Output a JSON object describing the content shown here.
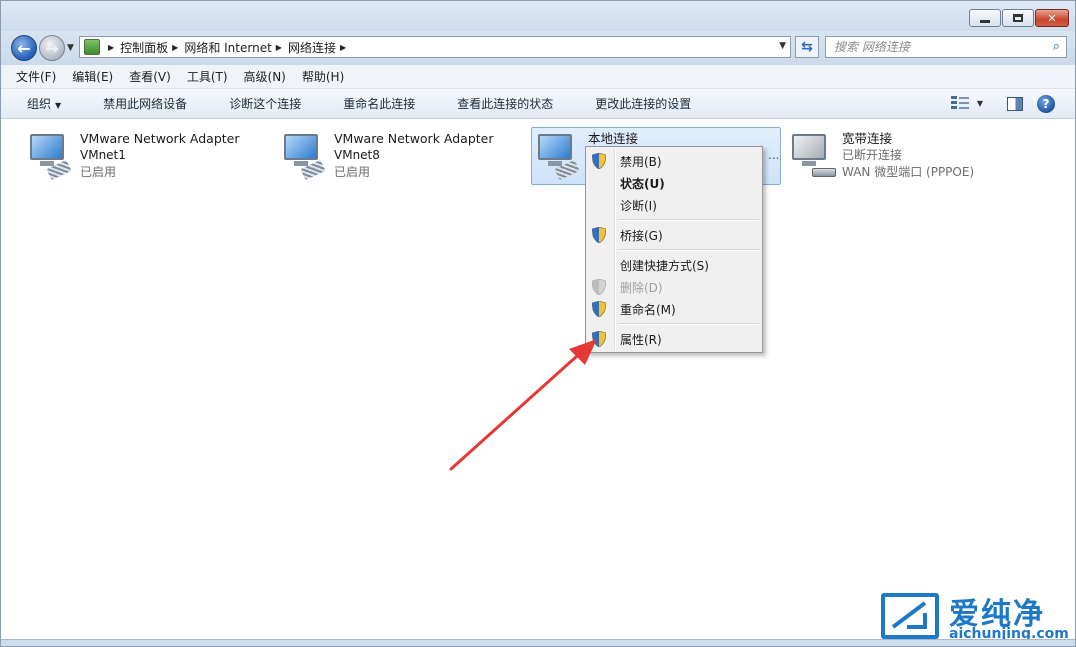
{
  "address": {
    "crumbs": [
      "控制面板",
      "网络和 Internet",
      "网络连接"
    ]
  },
  "search": {
    "placeholder": "搜索 网络连接"
  },
  "menu": [
    "文件(F)",
    "编辑(E)",
    "查看(V)",
    "工具(T)",
    "高级(N)",
    "帮助(H)"
  ],
  "commands": {
    "organize": "组织",
    "items": [
      "禁用此网络设备",
      "诊断这个连接",
      "重命名此连接",
      "查看此连接的状态",
      "更改此连接的设置"
    ]
  },
  "connections": [
    {
      "name": "VMware Network Adapter",
      "sub": "VMnet1",
      "status": "已启用"
    },
    {
      "name": "VMware Network Adapter",
      "sub": "VMnet8",
      "status": "已启用"
    },
    {
      "name": "本地连接",
      "sub": "",
      "status": ""
    },
    {
      "name": "宽带连接",
      "sub": "已断开连接",
      "status": "WAN 微型端口 (PPPOE)"
    }
  ],
  "context_menu": {
    "disable": "禁用(B)",
    "status": "状态(U)",
    "diagnose": "诊断(I)",
    "bridge": "桥接(G)",
    "shortcut": "创建快捷方式(S)",
    "delete": "删除(D)",
    "rename": "重命名(M)",
    "properties": "属性(R)"
  },
  "truncated_suffix": "...",
  "watermark": {
    "cn": "爱纯净",
    "en": "aichunjing.com"
  },
  "colors": {
    "accent": "#1e78c8",
    "arrow": "#e53935",
    "selection": "#cfe3f8"
  }
}
